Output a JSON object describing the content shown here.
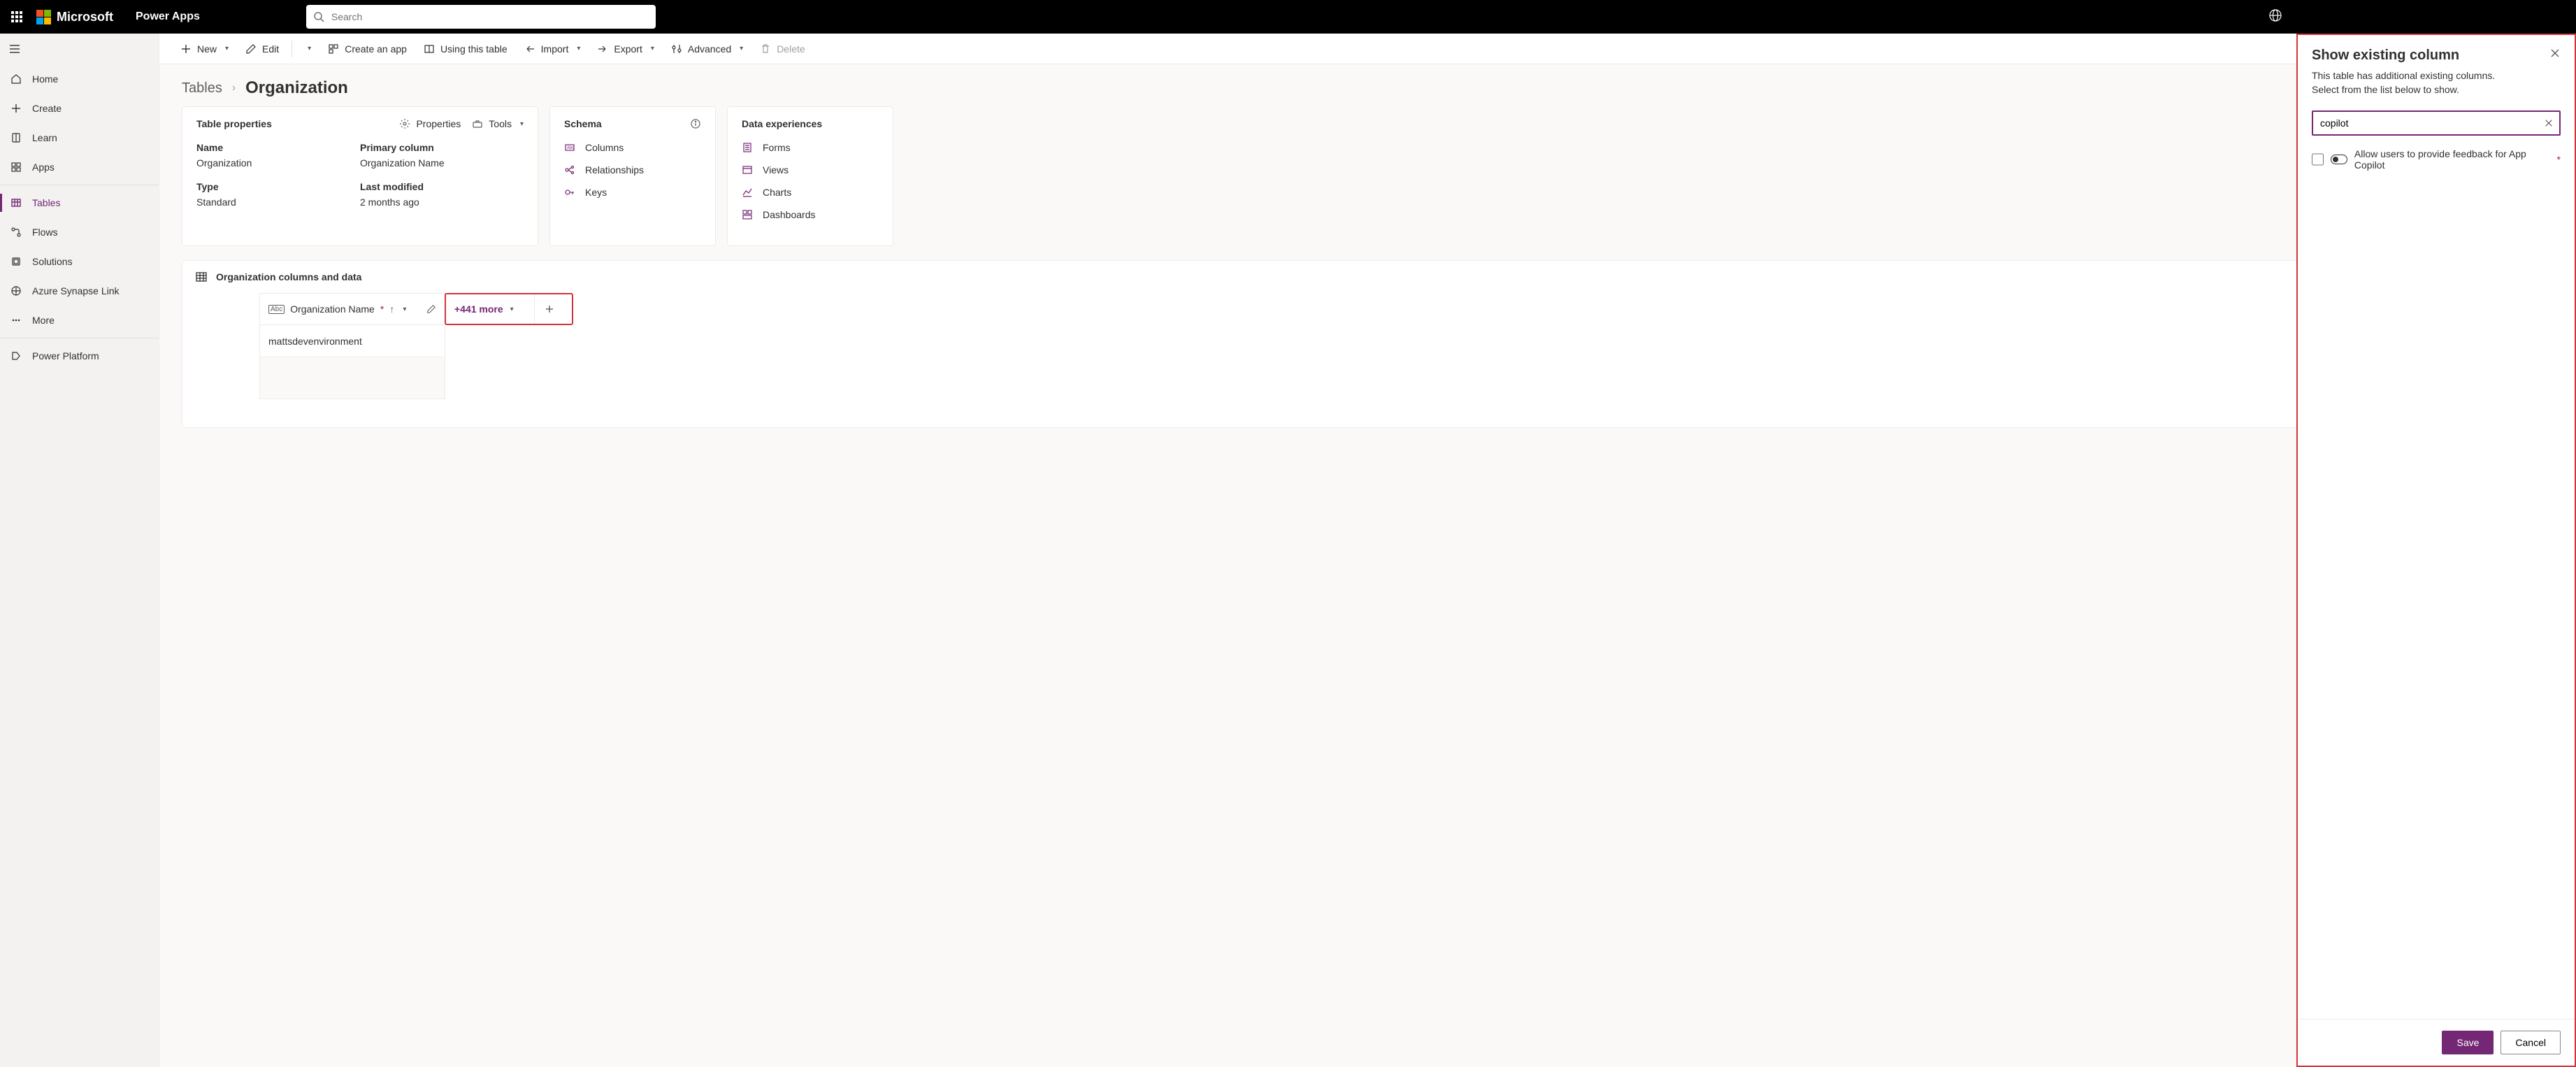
{
  "header": {
    "brand": "Microsoft",
    "app": "Power Apps",
    "search_placeholder": "Search"
  },
  "nav": {
    "items": [
      {
        "label": "Home"
      },
      {
        "label": "Create"
      },
      {
        "label": "Learn"
      },
      {
        "label": "Apps"
      },
      {
        "label": "Tables"
      },
      {
        "label": "Flows"
      },
      {
        "label": "Solutions"
      },
      {
        "label": "Azure Synapse Link"
      },
      {
        "label": "More"
      },
      {
        "label": "Power Platform"
      }
    ]
  },
  "cmdbar": {
    "new": "New",
    "edit": "Edit",
    "create_app": "Create an app",
    "using_table": "Using this table",
    "import": "Import",
    "export": "Export",
    "advanced": "Advanced",
    "delete": "Delete"
  },
  "breadcrumb": {
    "root": "Tables",
    "current": "Organization"
  },
  "props_card": {
    "title": "Table properties",
    "properties_link": "Properties",
    "tools_link": "Tools",
    "name_label": "Name",
    "name_value": "Organization",
    "primary_label": "Primary column",
    "primary_value": "Organization Name",
    "type_label": "Type",
    "type_value": "Standard",
    "modified_label": "Last modified",
    "modified_value": "2 months ago"
  },
  "schema_card": {
    "title": "Schema",
    "items": [
      "Columns",
      "Relationships",
      "Keys"
    ]
  },
  "dataexp_card": {
    "title": "Data experiences",
    "items": [
      "Forms",
      "Views",
      "Charts",
      "Dashboards"
    ]
  },
  "data_section": {
    "title": "Organization columns and data",
    "col_name": "Organization Name",
    "more_count": "+441 more",
    "row_value": "mattsdevenvironment"
  },
  "flyout": {
    "title": "Show existing column",
    "desc1": "This table has additional existing columns.",
    "desc2": "Select from the list below to show.",
    "search_value": "copilot",
    "option_label": "Allow users to provide feedback for App Copilot",
    "save": "Save",
    "cancel": "Cancel"
  }
}
